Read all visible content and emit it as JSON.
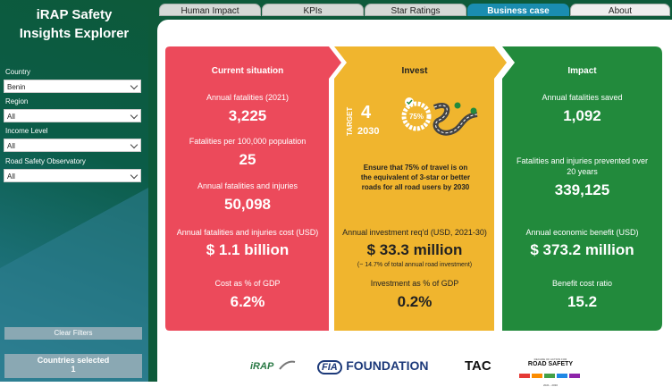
{
  "app": {
    "title_line1": "iRAP Safety",
    "title_line2": "Insights Explorer"
  },
  "tabs": [
    {
      "label": "Human Impact"
    },
    {
      "label": "KPIs"
    },
    {
      "label": "Star Ratings"
    },
    {
      "label": "Business case"
    },
    {
      "label": "About"
    }
  ],
  "filters": {
    "country": {
      "label": "Country",
      "value": "Benin"
    },
    "region": {
      "label": "Region",
      "value": "All"
    },
    "income": {
      "label": "Income Level",
      "value": "All"
    },
    "observatory": {
      "label": "Road Safety Observatory",
      "value": "All"
    }
  },
  "clear_filters": "Clear Filters",
  "countries_selected": {
    "label": "Countries selected",
    "value": "1"
  },
  "current": {
    "heading": "Current situation",
    "items": [
      {
        "label": "Annual fatalities (2021)",
        "value": "3,225"
      },
      {
        "label": "Fatalities per 100,000 population",
        "value": "25"
      },
      {
        "label": "Annual fatalities and injuries",
        "value": "50,098"
      },
      {
        "label": "Annual fatalities and injuries cost (USD)",
        "value": "$ 1.1 billion"
      },
      {
        "label": "Cost as % of GDP",
        "value": "6.2%"
      }
    ]
  },
  "invest": {
    "heading": "Invest",
    "target_word": "TARGET",
    "target_number": "4",
    "target_year": "2030",
    "target_pct": "75%",
    "statement": "Ensure that 75% of travel is on the equivalent of 3-star or better roads for all road users by 2030",
    "items": [
      {
        "label": "Annual investment req'd (USD, 2021-30)",
        "value": "$ 33.3 million"
      },
      {
        "label": "Investment as % of GDP",
        "value": "0.2%"
      }
    ],
    "note_prefix": "(~",
    "note_pct": "14.7%",
    "note_suffix": "of total annual road investment)"
  },
  "impact": {
    "heading": "Impact",
    "items": [
      {
        "label": "Annual fatalities saved",
        "value": "1,092"
      },
      {
        "label": "Fatalities and injuries prevented over",
        "label2": "20 years",
        "value": "339,125"
      },
      {
        "label": "Annual economic benefit (USD)",
        "value": "$ 373.2 million"
      },
      {
        "label": "Benefit cost ratio",
        "value": "15.2"
      }
    ]
  },
  "logos": {
    "irap": "iRAP",
    "fia_mark": "FIA",
    "fia_text": "FOUNDATION",
    "tac": "TAC",
    "decade_top": "DECADE OF ACTION FOR",
    "decade_main": "ROAD SAFETY",
    "decade_years": "2021 - 2030"
  },
  "colors": {
    "red": "#ec4a5b",
    "yellow": "#f0b52e",
    "green": "#228a3c",
    "tab_active": "#1a8db0",
    "sidebar": "#0d5a3a"
  }
}
